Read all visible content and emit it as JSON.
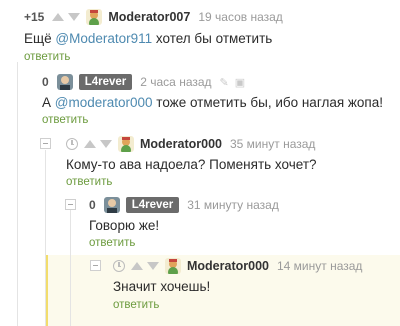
{
  "comments": [
    {
      "rating": "+15",
      "username": "Moderator007",
      "time": "19 часов назад",
      "mention": "@Moderator911",
      "text_before": "Ещё ",
      "text_after": " хотел бы отметить",
      "reply": "ответить"
    },
    {
      "rating": "0",
      "username": "L4rever",
      "time": "2 часа назад",
      "mention": "@moderator000",
      "text_before": "А ",
      "text_after": " тоже отметить бы, ибо наглая жопа!",
      "reply": "ответить"
    },
    {
      "username": "Moderator000",
      "time": "35 минут назад",
      "text": "Кому-то ава надоела? Поменять хочет?",
      "reply": "ответить"
    },
    {
      "rating": "0",
      "username": "L4rever",
      "time": "31 минуту назад",
      "text": "Говорю же!",
      "reply": "ответить"
    },
    {
      "username": "Moderator000",
      "time": "14 минут назад",
      "text": "Значит хочешь!",
      "reply": "ответить"
    }
  ],
  "colors": {
    "reply_link": "#6c9b3e",
    "mention": "#4e8ab0",
    "badge": "#6b6b6b",
    "highlight_bg": "#fcfaec"
  }
}
